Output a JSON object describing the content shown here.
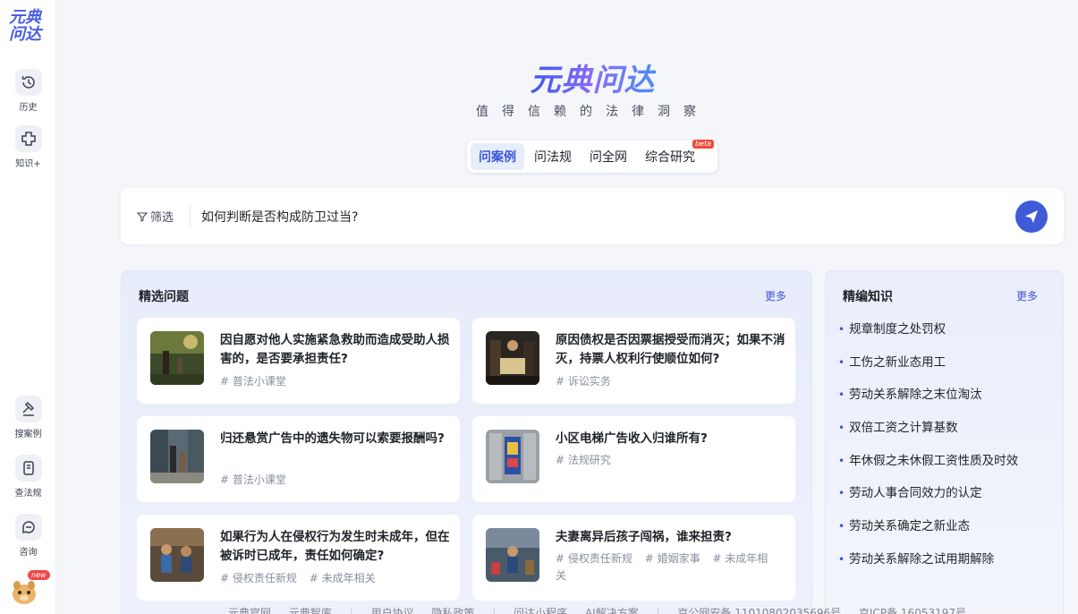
{
  "sidebar": {
    "logo_line1": "元典",
    "logo_line2": "问达",
    "items_top": [
      {
        "label": "历史",
        "icon": "history-icon"
      },
      {
        "label": "知识+",
        "icon": "knowledge-icon"
      }
    ],
    "items_bottom": [
      {
        "label": "搜案例",
        "icon": "gavel-icon"
      },
      {
        "label": "查法规",
        "icon": "book-icon"
      },
      {
        "label": "咨询",
        "icon": "consult-icon"
      }
    ],
    "avatar_badge": "new"
  },
  "brand": {
    "title": "元典问达",
    "subtitle": "值得信赖的法律洞察"
  },
  "tabs": [
    {
      "label": "问案例",
      "active": true
    },
    {
      "label": "问法规",
      "active": false
    },
    {
      "label": "问全网",
      "active": false
    },
    {
      "label": "综合研究",
      "active": false,
      "badge": "beta"
    }
  ],
  "search": {
    "filter_label": "筛选",
    "value": "如何判断是否构成防卫过当?"
  },
  "featured": {
    "title": "精选问题",
    "more": "更多",
    "cards": [
      {
        "title": "因自愿对他人实施紧急救助而造成受助人损害的，是否要承担责任?",
        "tags": [
          "# 普法小课堂"
        ]
      },
      {
        "title": "原因债权是否因票据授受而消灭；如果不消灭，持票人权利行使顺位如何?",
        "tags": [
          "# 诉讼实务"
        ]
      },
      {
        "title": "归还悬赏广告中的遗失物可以索要报酬吗?",
        "tags": [
          "# 普法小课堂"
        ]
      },
      {
        "title": "小区电梯广告收入归谁所有?",
        "tags": [
          "# 法规研究"
        ]
      },
      {
        "title": "如果行为人在侵权行为发生时未成年，但在被诉时已成年，责任如何确定?",
        "tags": [
          "# 侵权责任新规",
          "# 未成年相关"
        ]
      },
      {
        "title": "夫妻离异后孩子闯祸，谁来担责?",
        "tags": [
          "# 侵权责任新规",
          "# 婚姻家事",
          "# 未成年相关"
        ]
      }
    ]
  },
  "knowledge": {
    "title": "精编知识",
    "more": "更多",
    "items": [
      "规章制度之处罚权",
      "工伤之新业态用工",
      "劳动关系解除之末位淘汰",
      "双倍工资之计算基数",
      "年休假之未休假工资性质及时效",
      "劳动人事合同效力的认定",
      "劳动关系确定之新业态",
      "劳动关系解除之试用期解除"
    ]
  },
  "footer": {
    "links": [
      "元典官网",
      "元典智库",
      "用户协议",
      "隐私政策",
      "问达小程序",
      "AI解决方案",
      "京公网安备 11010802035696号",
      "京ICP备 16053197号"
    ]
  }
}
